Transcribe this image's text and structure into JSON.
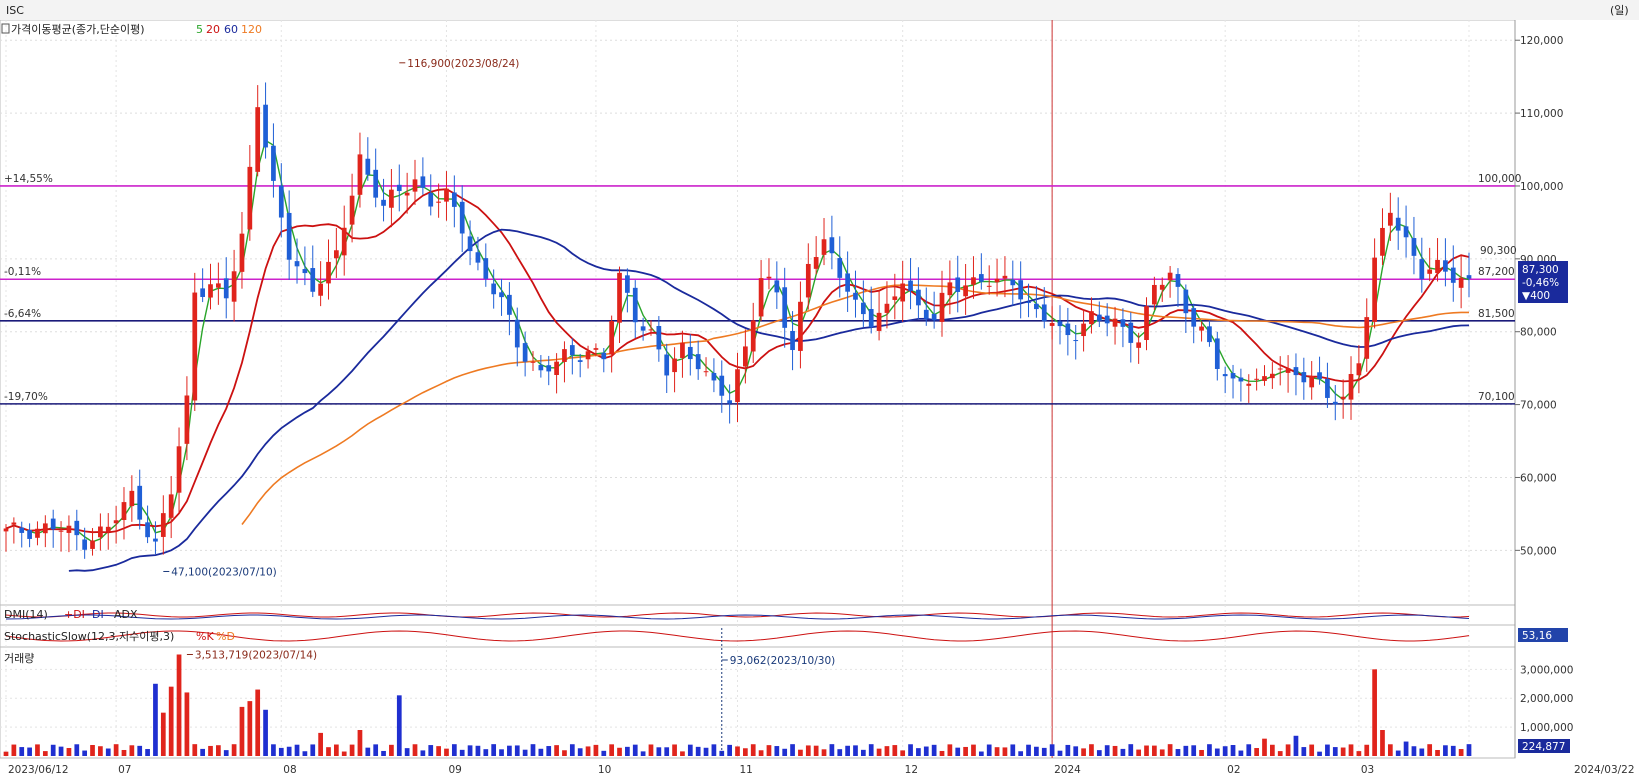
{
  "header": {
    "symbol": "ISC",
    "unit": "(일)"
  },
  "chart_data": {
    "type": "candlestick",
    "symbol": "ISC",
    "price_axis": {
      "ylim": [
        42500,
        122500
      ],
      "ticks": [
        "50,000",
        "60,000",
        "70,000",
        "80,000",
        "90,000",
        "100,000",
        "110,000",
        "120,000"
      ],
      "tick_values": [
        50000,
        60000,
        70000,
        80000,
        90000,
        100000,
        110000,
        120000
      ]
    },
    "x_labels": [
      {
        "text": "2023/06/12",
        "index": 0
      },
      {
        "text": "07",
        "index": 14
      },
      {
        "text": "08",
        "index": 35
      },
      {
        "text": "09",
        "index": 56
      },
      {
        "text": "10",
        "index": 75
      },
      {
        "text": "11",
        "index": 93
      },
      {
        "text": "12",
        "index": 114
      },
      {
        "text": "2024",
        "index": 133
      },
      {
        "text": "02",
        "index": 155
      },
      {
        "text": "03",
        "index": 172
      },
      {
        "text": "2024/03/22",
        "index": 186
      }
    ],
    "ma_legend": {
      "title": "가격이동평균(종가,단순이평)",
      "periods": [
        "5",
        "20",
        "60",
        "120"
      ],
      "colors": [
        "#2aa52a",
        "#cc1111",
        "#1a2a9c",
        "#ee7a22"
      ]
    },
    "close_points": [
      [
        0,
        52500
      ],
      [
        6,
        53200
      ],
      [
        10,
        51400
      ],
      [
        13,
        53000
      ],
      [
        16,
        57500
      ],
      [
        19,
        50600
      ],
      [
        21,
        58000
      ],
      [
        23,
        70500
      ],
      [
        24,
        85800
      ],
      [
        26,
        86400
      ],
      [
        28,
        84500
      ],
      [
        30,
        93000
      ],
      [
        32,
        112000
      ],
      [
        34,
        99500
      ],
      [
        36,
        90500
      ],
      [
        39,
        86200
      ],
      [
        42,
        90000
      ],
      [
        45,
        104000
      ],
      [
        48,
        97000
      ],
      [
        50,
        99200
      ],
      [
        52,
        101000
      ],
      [
        54,
        97800
      ],
      [
        56,
        98400
      ],
      [
        58,
        94500
      ],
      [
        60,
        89000
      ],
      [
        63,
        84000
      ],
      [
        65,
        78500
      ],
      [
        68,
        74200
      ],
      [
        71,
        76500
      ],
      [
        74,
        77600
      ],
      [
        76,
        76200
      ],
      [
        78,
        87300
      ],
      [
        80,
        82500
      ],
      [
        82,
        79500
      ],
      [
        84,
        74400
      ],
      [
        86,
        77800
      ],
      [
        88,
        76100
      ],
      [
        90,
        72200
      ],
      [
        92,
        70500
      ],
      [
        94,
        78100
      ],
      [
        96,
        87500
      ],
      [
        98,
        85000
      ],
      [
        100,
        77400
      ],
      [
        102,
        90200
      ],
      [
        104,
        91600
      ],
      [
        106,
        88000
      ],
      [
        108,
        84000
      ],
      [
        110,
        81500
      ],
      [
        112,
        82500
      ],
      [
        114,
        87600
      ],
      [
        116,
        83400
      ],
      [
        118,
        81600
      ],
      [
        120,
        86400
      ],
      [
        122,
        86800
      ],
      [
        124,
        87100
      ],
      [
        126,
        86300
      ],
      [
        128,
        87300
      ],
      [
        130,
        83600
      ],
      [
        132,
        81900
      ],
      [
        134,
        79700
      ],
      [
        136,
        80200
      ],
      [
        138,
        82000
      ],
      [
        140,
        81300
      ],
      [
        142,
        80500
      ],
      [
        144,
        79100
      ],
      [
        146,
        86000
      ],
      [
        148,
        87700
      ],
      [
        150,
        83500
      ],
      [
        152,
        80000
      ],
      [
        154,
        75200
      ],
      [
        156,
        73000
      ],
      [
        158,
        74100
      ],
      [
        160,
        72600
      ],
      [
        162,
        75600
      ],
      [
        164,
        73900
      ],
      [
        166,
        74300
      ],
      [
        168,
        70200
      ],
      [
        170,
        71400
      ],
      [
        172,
        76200
      ],
      [
        174,
        89300
      ],
      [
        176,
        96800
      ],
      [
        178,
        92700
      ],
      [
        180,
        88000
      ],
      [
        182,
        88500
      ],
      [
        184,
        87900
      ],
      [
        186,
        87300
      ]
    ],
    "annotations": [
      {
        "text": "116,900(2023/08/24)",
        "value": 116900,
        "index": 50
      },
      {
        "text": "47,100(2023/07/10)",
        "value": 47100,
        "index": 20
      }
    ],
    "hlines": [
      {
        "pct": "+14,55%",
        "value": 100000,
        "value_label": "100,000",
        "color": "#cc22cc"
      },
      {
        "pct": "-0,11%",
        "value": 87200,
        "value_label": "87,200",
        "color": "#cc22cc"
      },
      {
        "pct": "-6,64%",
        "value": 81500,
        "value_label": "81,500",
        "color": "#1a1a7a"
      },
      {
        "pct": "-19,70%",
        "value": 70100,
        "value_label": "70,100",
        "color": "#1a1a7a"
      }
    ],
    "partial_labels": [
      "90,300"
    ],
    "current": {
      "price": "87,300",
      "change_pct": "-0,46%",
      "change": "▼400"
    },
    "vertical_marker_index": 133,
    "panels": {
      "dmi": {
        "label": "DMI(14)",
        "series": [
          "+DI",
          "-DI",
          "ADX"
        ],
        "colors": [
          "#cc1111",
          "#1a2a9c",
          "#222222"
        ]
      },
      "stochastic": {
        "label": "StochasticSlow(12,3,지수이평,3)",
        "series": [
          "%K",
          "%D"
        ],
        "colors": [
          "#cc1111",
          "#ee7a22"
        ],
        "value_label": "53,16"
      },
      "volume": {
        "label": "거래량",
        "ticks": [
          "1,000,000",
          "2,000,000",
          "3,000,000"
        ],
        "tick_values": [
          1000000,
          2000000,
          3000000
        ],
        "ylim": [
          0,
          3600000
        ],
        "annotations": [
          {
            "text": "3,513,719(2023/07/14)",
            "value": 3513719,
            "index": 23
          },
          {
            "text": "93,062(2023/10/30)",
            "value": 93062,
            "index": 91
          }
        ],
        "current": "224,877",
        "spikes": [
          [
            19,
            2500000
          ],
          [
            22,
            3513719
          ],
          [
            21,
            2400000
          ],
          [
            23,
            2200000
          ],
          [
            20,
            1500000
          ],
          [
            30,
            1700000
          ],
          [
            31,
            1900000
          ],
          [
            32,
            2300000
          ],
          [
            33,
            1600000
          ],
          [
            50,
            2100000
          ],
          [
            174,
            3000000
          ],
          [
            175,
            900000
          ],
          [
            164,
            700000
          ],
          [
            160,
            600000
          ],
          [
            178,
            500000
          ],
          [
            45,
            900000
          ],
          [
            40,
            800000
          ]
        ]
      }
    }
  }
}
